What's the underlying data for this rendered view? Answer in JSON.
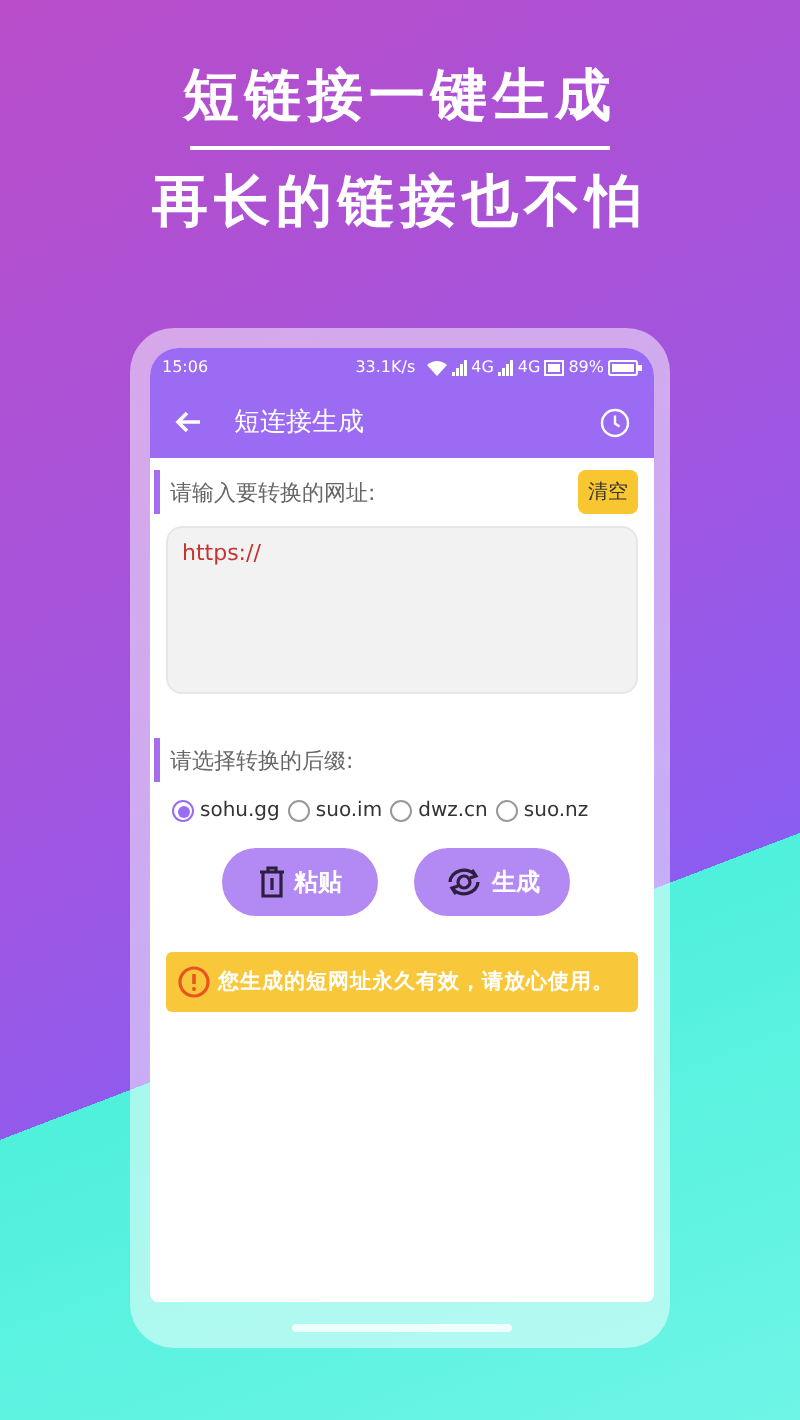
{
  "headline": "短链接一键生成",
  "subheadline": "再长的链接也不怕",
  "status_bar": {
    "time": "15:06",
    "speed": "33.1K/s",
    "network_1": "4G",
    "network_2": "4G",
    "battery": "89%"
  },
  "app_bar": {
    "title": "短连接生成"
  },
  "url_section": {
    "label": "请输入要转换的网址:",
    "clear_button": "清空",
    "value": "https://"
  },
  "suffix_section": {
    "label": "请选择转换的后缀:"
  },
  "suffixes": [
    {
      "label": "sohu.gg",
      "selected": true
    },
    {
      "label": "suo.im",
      "selected": false
    },
    {
      "label": "dwz.cn",
      "selected": false
    },
    {
      "label": "suo.nz",
      "selected": false
    }
  ],
  "buttons": [
    {
      "kind": "paste",
      "label": "粘贴"
    },
    {
      "kind": "generate",
      "label": "生成"
    }
  ],
  "notice": "您生成的短网址永久有效，请放心使用。"
}
